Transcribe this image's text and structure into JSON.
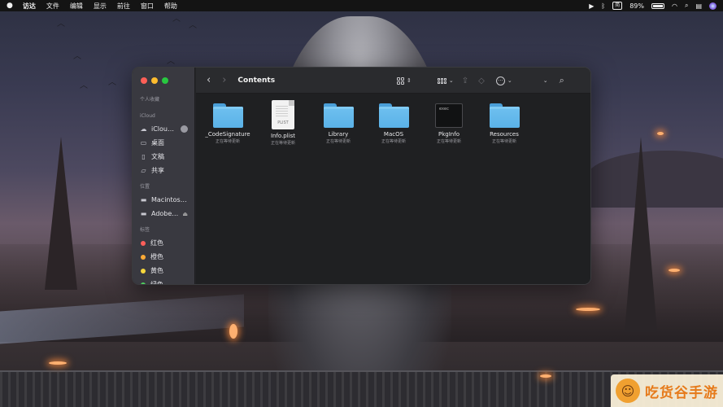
{
  "menubar": {
    "app_name": "访达",
    "items": [
      "文件",
      "编辑",
      "显示",
      "前往",
      "窗口",
      "帮助"
    ],
    "input_method": "简",
    "battery_percent": "89%"
  },
  "finder": {
    "title": "Contents",
    "sidebar": {
      "favorites_heading": "个人收藏",
      "icloud_heading": "iCloud",
      "icloud_items": [
        {
          "label": "iClou…",
          "icon": "cloud-icon"
        },
        {
          "label": "桌面",
          "icon": "desktop-icon"
        },
        {
          "label": "文稿",
          "icon": "document-icon"
        },
        {
          "label": "共享",
          "icon": "shared-folder-icon"
        }
      ],
      "locations_heading": "位置",
      "location_items": [
        {
          "label": "Macintos…",
          "icon": "disk-icon"
        },
        {
          "label": "Adobe…",
          "icon": "disk-icon"
        }
      ],
      "tags_heading": "标签",
      "tag_items": [
        {
          "label": "红色",
          "color": "#ff5f5a"
        },
        {
          "label": "橙色",
          "color": "#fdaa36"
        },
        {
          "label": "黄色",
          "color": "#f5d63c"
        },
        {
          "label": "绿色",
          "color": "#4fce5d"
        }
      ]
    },
    "files": [
      {
        "name": "_CodeSignature",
        "status": "正在等待更新",
        "type": "folder"
      },
      {
        "name": "Info.plist",
        "status": "正在等待更新",
        "type": "plist",
        "badge": "PLIST"
      },
      {
        "name": "Library",
        "status": "正在等待更新",
        "type": "folder"
      },
      {
        "name": "MacOS",
        "status": "正在等待更新",
        "type": "folder"
      },
      {
        "name": "PkgInfo",
        "status": "正在等待更新",
        "type": "exec",
        "badge": "exec"
      },
      {
        "name": "Resources",
        "status": "正在等待更新",
        "type": "folder"
      }
    ]
  },
  "watermark": {
    "text": "吃货谷手游"
  },
  "colors": {
    "folder": "#5ab2e8",
    "window_bg": "#242528",
    "sidebar_bg": "#3a3a42"
  }
}
